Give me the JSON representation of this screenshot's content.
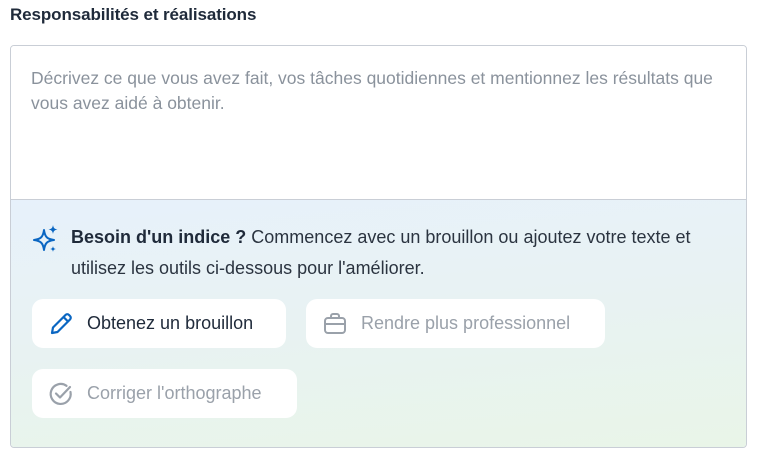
{
  "section": {
    "title": "Responsabilités et réalisations"
  },
  "editor": {
    "value": "",
    "placeholder": "Décrivez ce que vous avez fait, vos tâches quotidiennes et mentionnez les résultats que vous avez aidé à obtenir."
  },
  "hint": {
    "icon": "sparkle-icon",
    "bold": "Besoin d'un indice ?",
    "text": " Commencez avec un brouillon ou ajoutez votre texte et utilisez les outils ci-dessous pour l'améliorer."
  },
  "tools": {
    "draft": {
      "label": "Obtenez un brouillon",
      "icon": "pencil-icon",
      "enabled": true
    },
    "professional": {
      "label": "Rendre plus professionnel",
      "icon": "briefcase-icon",
      "enabled": false
    },
    "spelling": {
      "label": "Corriger l'orthographe",
      "icon": "check-circle-icon",
      "enabled": false
    }
  },
  "colors": {
    "accent": "#0a66c2",
    "disabled": "#9aa1aa",
    "text": "#1f2a3a"
  }
}
